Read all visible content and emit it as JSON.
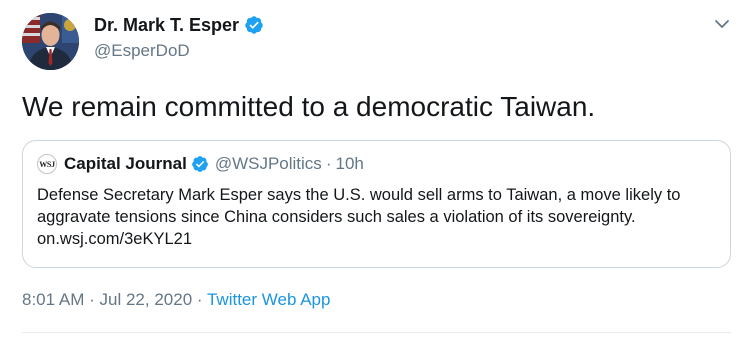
{
  "author": {
    "name": "Dr. Mark T. Esper",
    "handle": "@EsperDoD"
  },
  "tweet": {
    "text": "We remain committed to a democratic Taiwan."
  },
  "quoted_tweet": {
    "logo_text": "WSJ",
    "name": "Capital Journal",
    "handle": "@WSJPolitics",
    "separator": "·",
    "time": "10h",
    "text": "Defense Secretary Mark Esper says the U.S. would sell arms to Taiwan, a move likely to aggravate tensions since China considers such sales a violation of its sovereignty. on.wsj.com/3eKYL21"
  },
  "meta": {
    "time": "8:01 AM",
    "separator": "·",
    "date": "Jul 22, 2020",
    "separator2": "·",
    "source": "Twitter Web App"
  },
  "colors": {
    "verified": "#1da1f2",
    "link": "#1b95e0",
    "secondary_text": "#657786",
    "border": "#ccd6dd"
  },
  "icons": {
    "verified": "verified-badge-icon",
    "caret": "chevron-down-icon"
  }
}
